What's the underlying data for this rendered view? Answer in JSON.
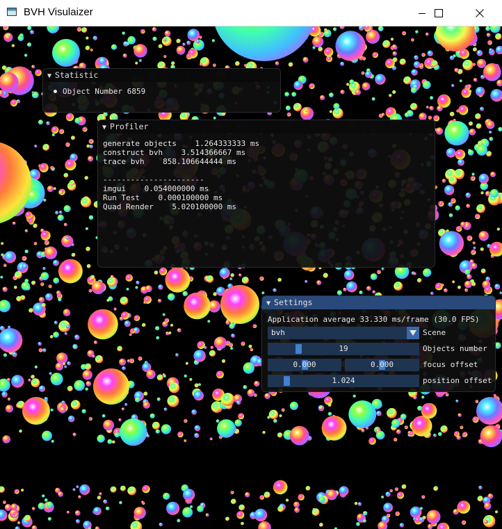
{
  "window": {
    "title": "BVH Visulaizer",
    "icon": "app-window-icon",
    "controls": [
      "minimize-icon",
      "maximize-icon",
      "close-icon"
    ]
  },
  "statistic": {
    "title": "Statistic",
    "object_number_label": "Object Number 6859"
  },
  "profiler": {
    "title": "Profiler",
    "lines": [
      "generate objects    1.264333333 ms",
      "construct bvh    3.514366667 ms",
      "trace bvh    858.106644444 ms",
      "",
      "----------------------",
      "imgui    0.054000000 ms",
      "Run Test    0.000100000 ms",
      "Quad Render    5.020100000 ms"
    ]
  },
  "settings": {
    "title": "Settings",
    "app_average": "Application average 33.330 ms/frame (30.0 FPS)",
    "scene": {
      "value": "bvh",
      "label": "Scene"
    },
    "objects_number": {
      "value": "19",
      "label": "Objects number"
    },
    "focus_offset": {
      "value_x": "0.000",
      "value_y": "0.000",
      "label": "focus offset"
    },
    "position_offset": {
      "value": "1.024",
      "label": "position offset"
    }
  },
  "colors": {
    "title_active": "#29497a",
    "frame_bg": "#1f3450",
    "grab": "#4280d0",
    "panel_bg": "#0f0f0f"
  }
}
